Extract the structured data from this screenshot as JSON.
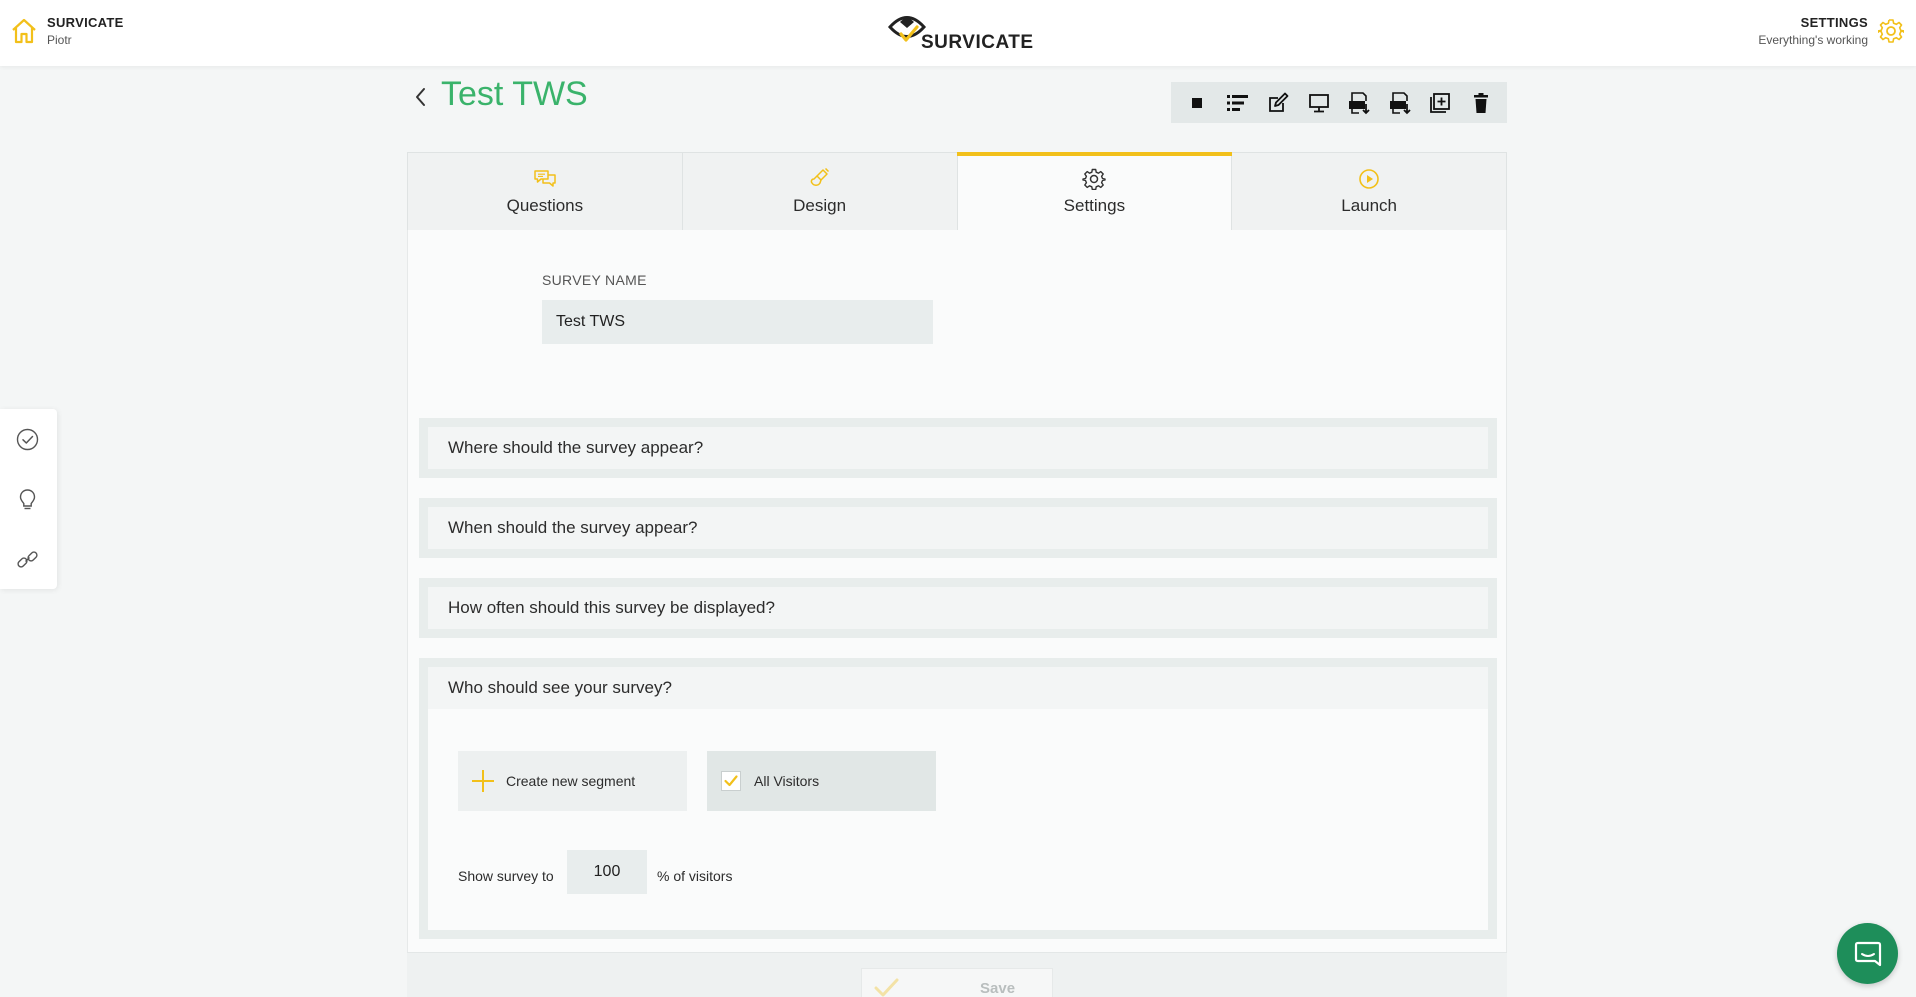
{
  "topbar": {
    "brand_title": "SURVICATE",
    "brand_user": "Piotr",
    "logo_text": "SURVICATE",
    "settings_title": "SETTINGS",
    "settings_status": "Everything's working"
  },
  "survey": {
    "title": "Test TWS"
  },
  "toolbar": {
    "icons": [
      "stop-icon",
      "list-icon",
      "edit-icon",
      "preview-icon",
      "export-csv-icon",
      "export-xls-icon",
      "duplicate-icon",
      "trash-icon"
    ]
  },
  "tabs": [
    {
      "label": "Questions",
      "icon": "chat-bubbles-icon",
      "active": false
    },
    {
      "label": "Design",
      "icon": "paintbrush-icon",
      "active": false
    },
    {
      "label": "Settings",
      "icon": "gear-icon",
      "active": true
    },
    {
      "label": "Launch",
      "icon": "play-icon",
      "active": false
    }
  ],
  "settings": {
    "survey_name_label": "SURVEY NAME",
    "survey_name_value": "Test TWS"
  },
  "sections": [
    {
      "title": "Where should the survey appear?"
    },
    {
      "title": "When should the survey appear?"
    },
    {
      "title": "How often should this survey be displayed?"
    },
    {
      "title": "Who should see your survey?"
    }
  ],
  "audience": {
    "create_segment_label": "Create new segment",
    "all_visitors_label": "All Visitors",
    "all_visitors_checked": true,
    "show_prefix": "Show survey to",
    "percent_value": "100",
    "show_suffix": "% of visitors"
  },
  "footer": {
    "save_label": "Save"
  },
  "colors": {
    "accent_yellow": "#f2c01a",
    "title_green": "#3ab36b",
    "chat_green": "#1e8e5a"
  }
}
